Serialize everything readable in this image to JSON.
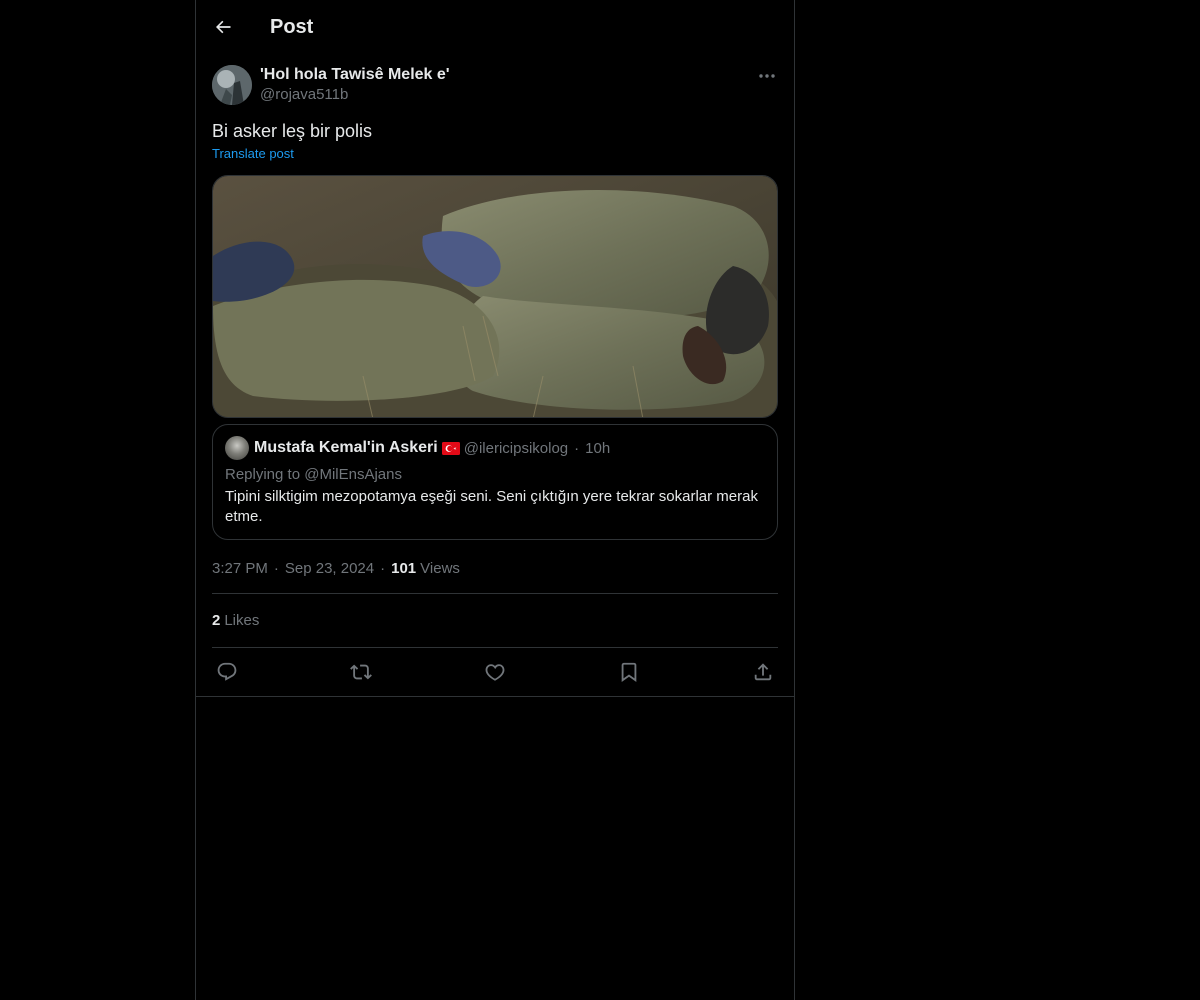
{
  "header": {
    "title": "Post"
  },
  "post": {
    "display_name": "'Hol hola Tawisê Melek e'",
    "handle": "@rojava511b",
    "text": "Bi asker leş bir polis",
    "translate_label": "Translate post",
    "time": "3:27 PM",
    "date": "Sep 23, 2024",
    "views_count": "101",
    "views_label": "Views",
    "likes_count": "2",
    "likes_label": "Likes"
  },
  "quote": {
    "display_name": "Mustafa Kemal'in Askeri",
    "handle": "@ilericipsikolog",
    "time": "10h",
    "replying_label": "Replying to",
    "replying_to": "@MilEnsAjans",
    "text": "Tipini silktigim mezopotamya eşeği seni. Seni çıktığın yere tekrar sokarlar merak etme."
  },
  "colors": {
    "background": "#000000",
    "text_primary": "#e7e9ea",
    "text_secondary": "#71767b",
    "accent": "#1d9bf0",
    "border": "#2f3336"
  },
  "icons": {
    "back": "arrow-left-icon",
    "more": "ellipsis-icon",
    "reply": "reply-bubble-icon",
    "repost": "repost-icon",
    "like": "heart-icon",
    "bookmark": "bookmark-icon",
    "share": "share-icon"
  }
}
